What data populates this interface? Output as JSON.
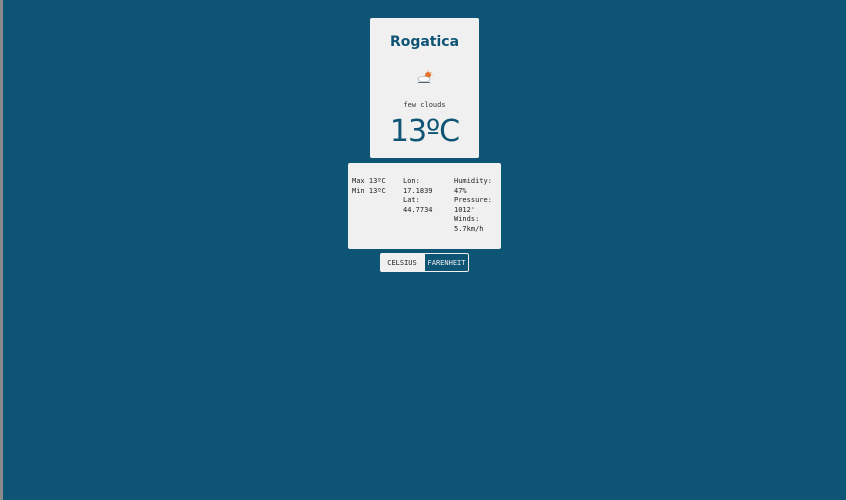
{
  "weather": {
    "city": "Rogatica",
    "description": "few clouds",
    "temperature": "13ºC",
    "icon": "few-clouds-icon"
  },
  "details": {
    "max": "Max 13ºC",
    "min": "Min 13ºC",
    "lon_label": "Lon:",
    "lon_value": "17.1839",
    "lat_label": "Lat:",
    "lat_value": "44.7734",
    "humidity_label": "Humidity:",
    "humidity_value": "47%",
    "pressure_label": "Pressure:",
    "pressure_value": "1012'",
    "winds_label": "Winds:",
    "winds_value": "5.7km/h"
  },
  "units": {
    "celsius_label": "CELSIUS",
    "fahrenheit_label": "FARENHEIT"
  },
  "colors": {
    "background": "#0e5474",
    "card": "#f0f0f0",
    "accent": "#0e5474"
  }
}
